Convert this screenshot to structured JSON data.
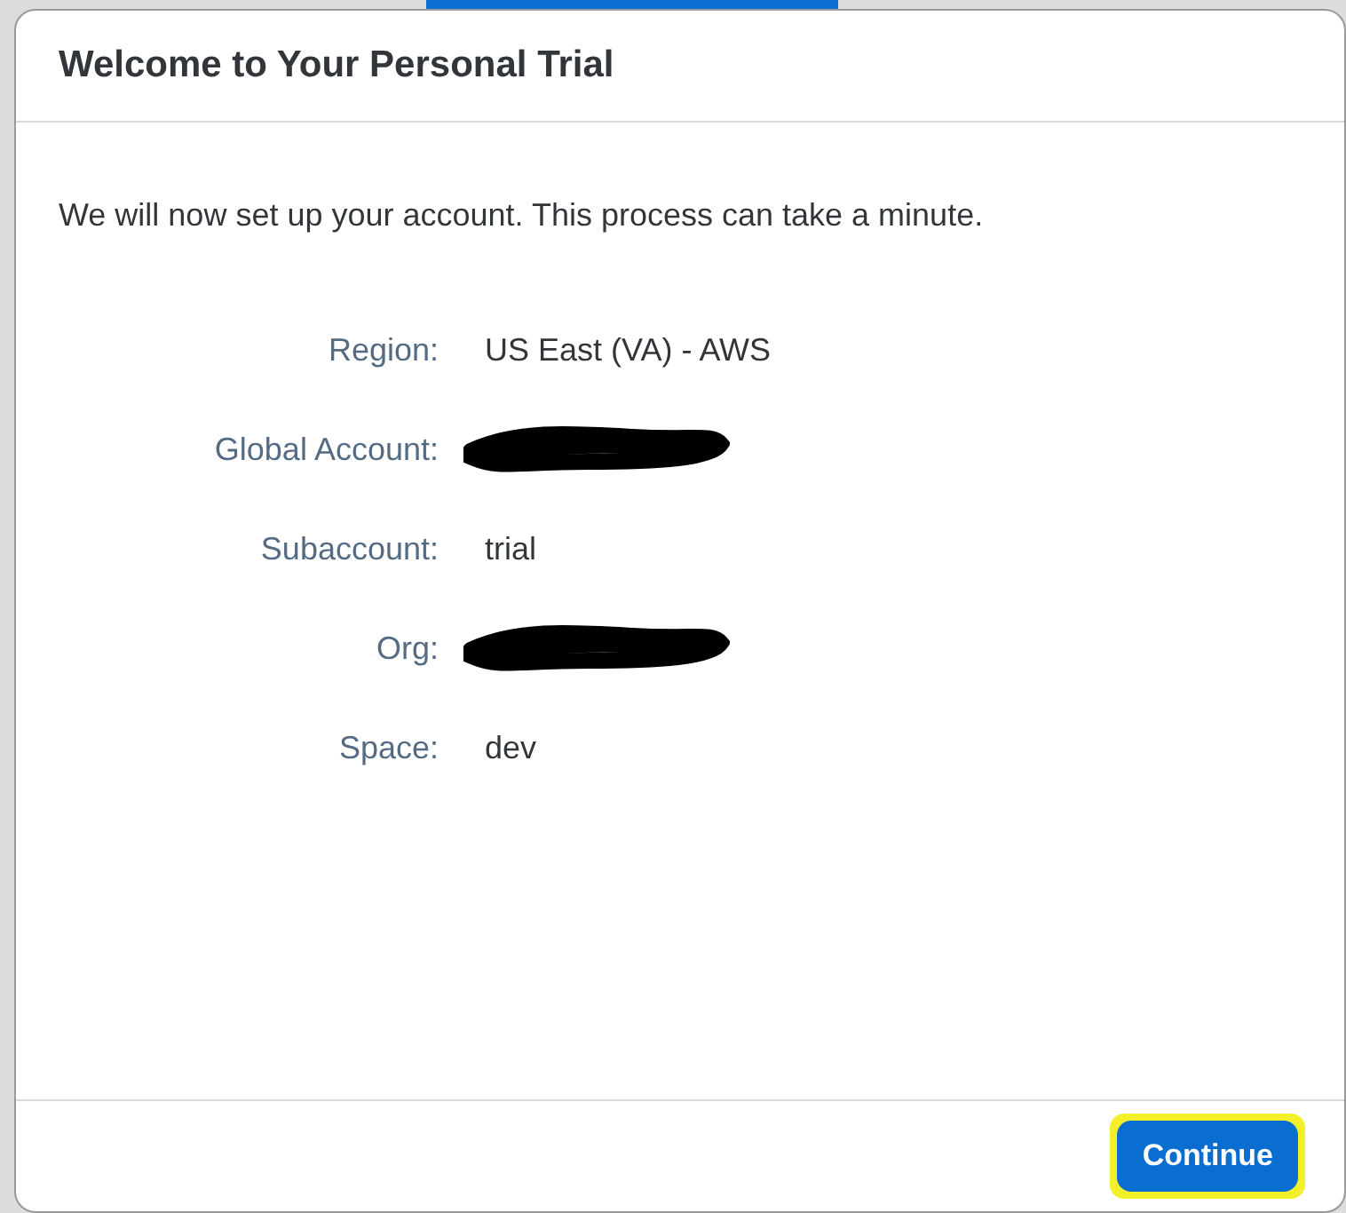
{
  "dialog": {
    "title": "Welcome to Your Personal Trial",
    "message": "We will now set up your account. This process can take a minute.",
    "fields": [
      {
        "label": "Region:",
        "value": "US East (VA) - AWS"
      },
      {
        "label": "Global Account:",
        "redacted": true
      },
      {
        "label": "Subaccount:",
        "value": "trial"
      },
      {
        "label": "Org:",
        "redacted": true
      },
      {
        "label": "Space:",
        "value": "dev"
      }
    ],
    "button": {
      "label": "Continue",
      "highlighted": true
    }
  }
}
